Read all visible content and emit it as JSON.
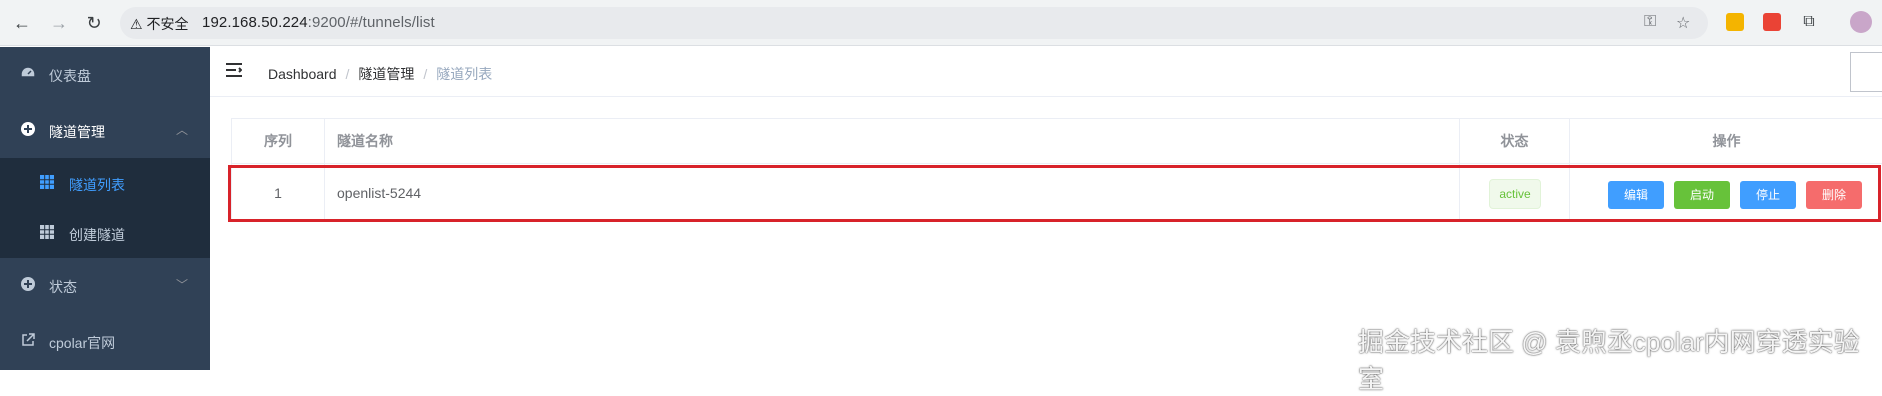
{
  "browser": {
    "security_label": "不安全",
    "url_host": "192.168.50.224",
    "url_rest": ":9200/#/tunnels/list"
  },
  "sidebar": {
    "items": [
      {
        "label": "仪表盘",
        "icon": "dashboard-icon"
      },
      {
        "label": "隧道管理",
        "icon": "plus-circle-icon",
        "expanded": true
      },
      {
        "label": "状态",
        "icon": "plus-circle-icon",
        "expanded": false
      },
      {
        "label": "cpolar官网",
        "icon": "external-link-icon"
      }
    ],
    "submenu": [
      {
        "label": "隧道列表",
        "icon": "grid-icon",
        "active": true
      },
      {
        "label": "创建隧道",
        "icon": "grid-icon",
        "active": false
      }
    ]
  },
  "breadcrumb": [
    "Dashboard",
    "隧道管理",
    "隧道列表"
  ],
  "table": {
    "headers": [
      "序列",
      "隧道名称",
      "状态",
      "操作"
    ],
    "rows": [
      {
        "index": "1",
        "name": "openlist-5244",
        "status": "active"
      }
    ],
    "actions": [
      "编辑",
      "启动",
      "停止",
      "删除"
    ]
  },
  "colors": {
    "sidebar_bg": "#304156",
    "active": "#409eff",
    "edit": "#409eff",
    "start": "#67c23a",
    "stop": "#409eff",
    "delete": "#f56c6c",
    "highlight": "#d8232a"
  },
  "watermark": "掘金技术社区 @ 袁煦丞cpolar内网穿透实验室"
}
